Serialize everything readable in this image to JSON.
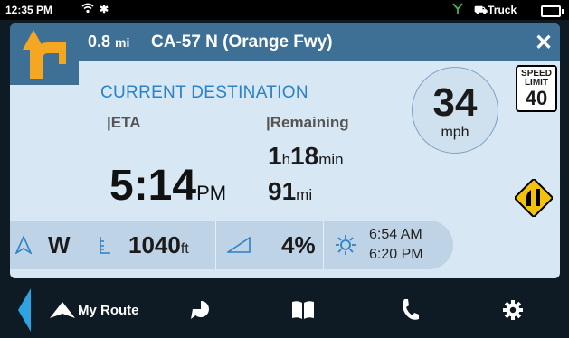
{
  "status": {
    "time": "12:35 PM",
    "profile": "Truck"
  },
  "header": {
    "distance": "0.8",
    "distance_unit": "mi",
    "road": "CA-57 N (Orange Fwy)"
  },
  "destination": {
    "heading": "CURRENT DESTINATION",
    "eta_label": "|ETA",
    "remaining_label": "|Remaining",
    "eta_time": "5:14",
    "eta_suffix": "PM",
    "remain_hours": "1",
    "remain_hours_unit": "h",
    "remain_minutes": "18",
    "remain_minutes_unit": "min",
    "remain_distance": "91",
    "remain_distance_unit": "mi"
  },
  "speed": {
    "value": "34",
    "unit": "mph"
  },
  "speed_limit": {
    "label_1": "SPEED",
    "label_2": "LIMIT",
    "value": "40"
  },
  "info": {
    "heading": "W",
    "elevation": "1040",
    "elevation_unit": "ft",
    "grade": "4%",
    "sunrise": "6:54 AM",
    "sunset": "6:20 PM"
  },
  "nav": {
    "my_route_label": "My Route"
  },
  "colors": {
    "header": "#3e6f95",
    "accent": "#2a82c7",
    "turn_arrow": "#f5a623",
    "panel": "#d8e7f4"
  }
}
